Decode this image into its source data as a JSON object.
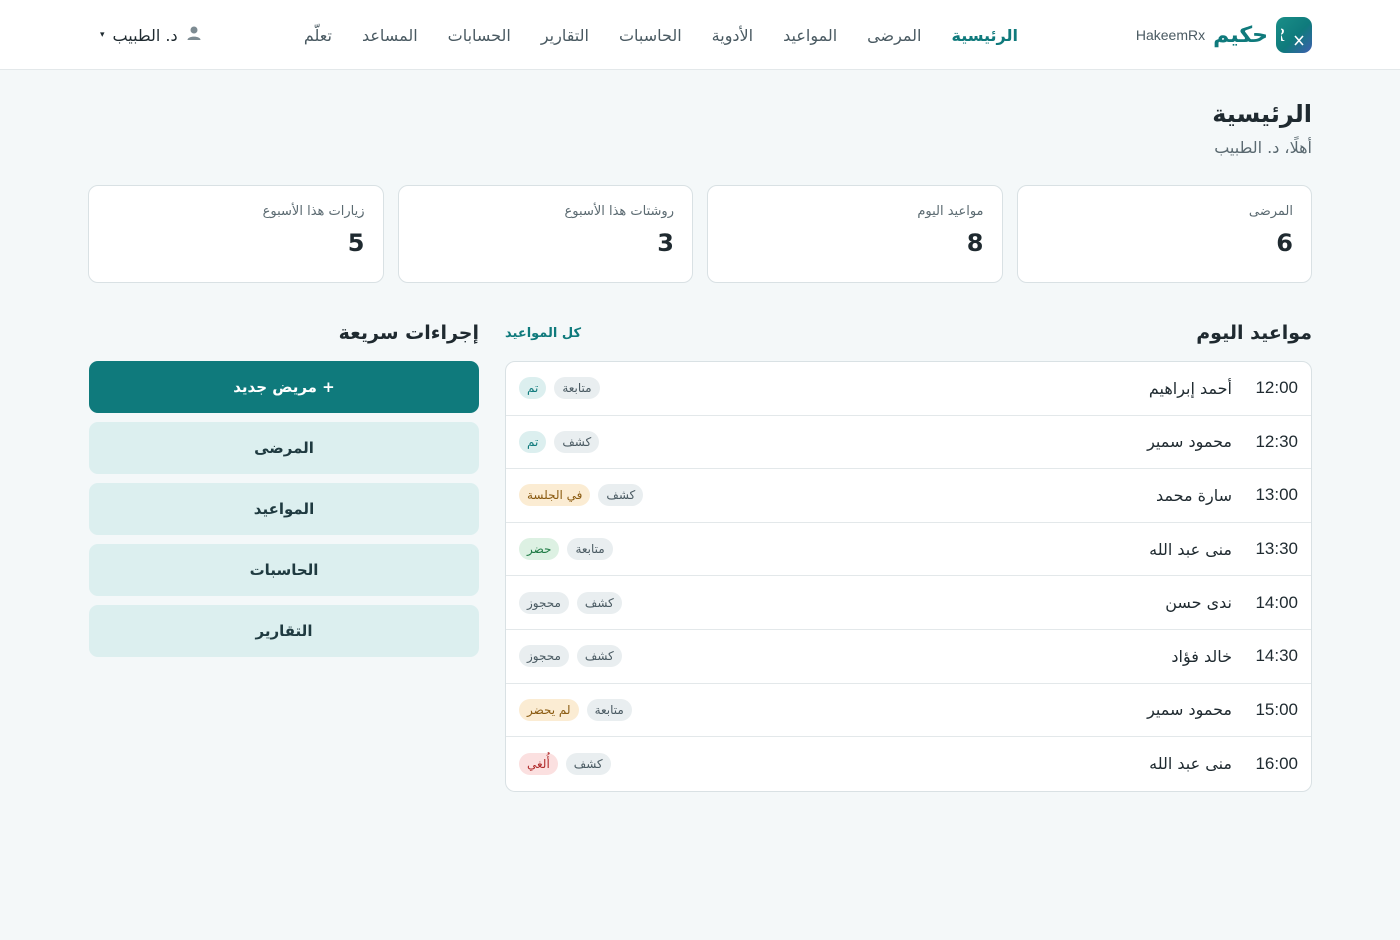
{
  "brand": {
    "name": "حكيم",
    "latin": "HakeemRx"
  },
  "nav": [
    {
      "label": "الرئيسية",
      "active": true
    },
    {
      "label": "المرضى"
    },
    {
      "label": "المواعيد"
    },
    {
      "label": "الأدوية"
    },
    {
      "label": "الحاسبات"
    },
    {
      "label": "التقارير"
    },
    {
      "label": "الحسابات"
    },
    {
      "label": "المساعد"
    },
    {
      "label": "تعلّم"
    }
  ],
  "user": {
    "name": "د. الطبيب",
    "icon": "user-icon",
    "caret": "▾"
  },
  "page": {
    "title": "الرئيسية",
    "subtitle": "أهلًا، د. الطبيب"
  },
  "stats": [
    {
      "label": "المرضى",
      "value": "6"
    },
    {
      "label": "مواعيد اليوم",
      "value": "8"
    },
    {
      "label": "روشتات هذا الأسبوع",
      "value": "3"
    },
    {
      "label": "زيارات هذا الأسبوع",
      "value": "5"
    }
  ],
  "appointments": {
    "title": "مواعيد اليوم",
    "link": "كل المواعيد",
    "rows": [
      {
        "time": "12:00",
        "name": "أحمد إبراهيم",
        "type": "متابعة",
        "status": "تم"
      },
      {
        "time": "12:30",
        "name": "محمود سمير",
        "type": "كشف",
        "status": "تم"
      },
      {
        "time": "13:00",
        "name": "سارة محمد",
        "type": "كشف",
        "status": "في الجلسة"
      },
      {
        "time": "13:30",
        "name": "منى عبد الله",
        "type": "متابعة",
        "status": "حضر"
      },
      {
        "time": "14:00",
        "name": "ندى حسن",
        "type": "كشف",
        "status": "محجوز"
      },
      {
        "time": "14:30",
        "name": "خالد فؤاد",
        "type": "كشف",
        "status": "محجوز"
      },
      {
        "time": "15:00",
        "name": "محمود سمير",
        "type": "متابعة",
        "status": "لم يحضر"
      },
      {
        "time": "16:00",
        "name": "منى عبد الله",
        "type": "كشف",
        "status": "أُلغي"
      }
    ]
  },
  "status_colors": {
    "تم": {
      "bg": "#dcefef",
      "fg": "#0f7a7c"
    },
    "في الجلسة": {
      "bg": "#fbecd3",
      "fg": "#8a5a10"
    },
    "حضر": {
      "bg": "#ddf1e3",
      "fg": "#1e7a44"
    },
    "محجوز": {
      "bg": "#e9eef0",
      "fg": "#4a5a62"
    },
    "لم يحضر": {
      "bg": "#fbecd3",
      "fg": "#8a5a10"
    },
    "أُلغي": {
      "bg": "#fbe0e0",
      "fg": "#b02a2a"
    }
  },
  "quick_actions": {
    "title": "إجراءات سريعة",
    "primary": "+ مريض جديد",
    "items": [
      "المرضى",
      "المواعيد",
      "الحاسبات",
      "التقارير"
    ]
  },
  "colors": {
    "accent": "#0f7a7c",
    "background": "#f4f8f9"
  }
}
